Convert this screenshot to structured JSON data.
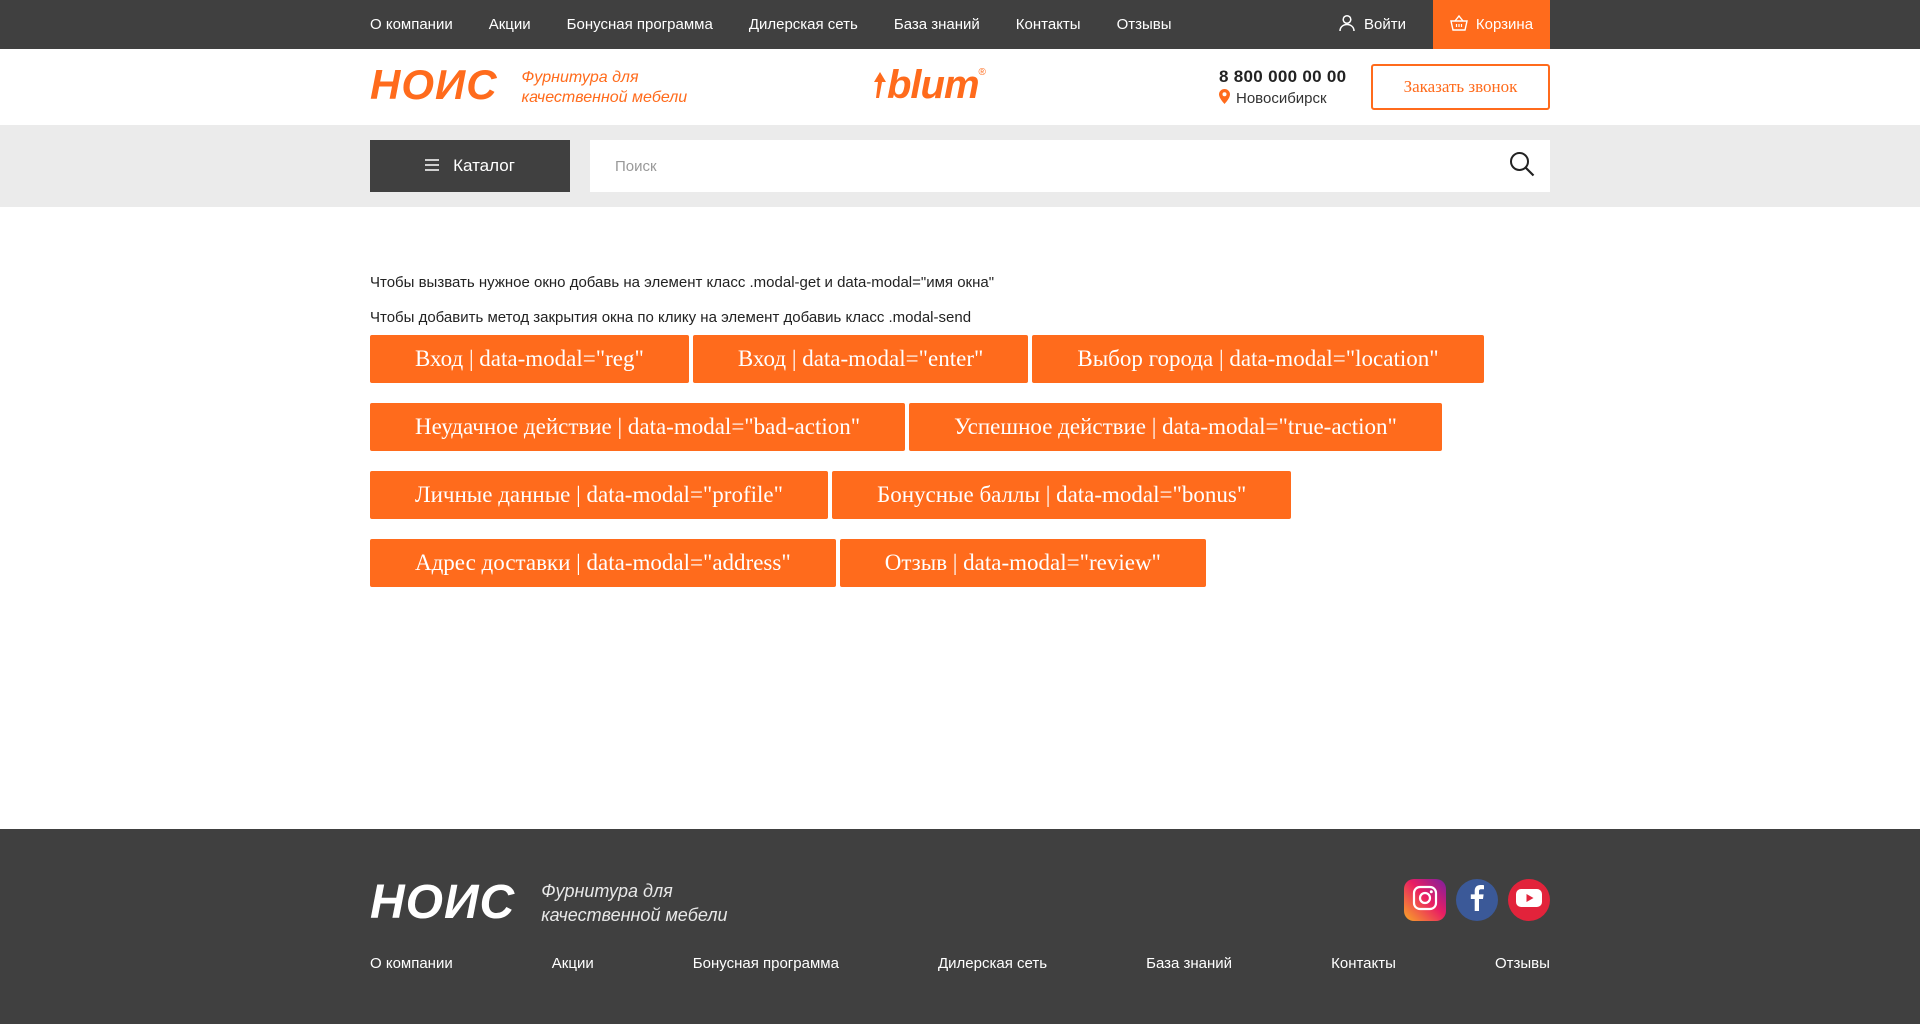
{
  "topbar": {
    "nav": [
      "О компании",
      "Акции",
      "Бонусная программа",
      "Дилерская сеть",
      "База знаний",
      "Контакты",
      "Отзывы"
    ],
    "login_label": "Войти",
    "cart_label": "Корзина"
  },
  "header": {
    "logo_text": "НОИС",
    "logo_tagline": "Фурнитура для качественной мебели",
    "brand_text": "blum",
    "brand_reg": "®",
    "phone": "8 800 000 00 00",
    "city": "Новосибирск",
    "callback_label": "Заказать звонок"
  },
  "search_band": {
    "catalog_label": "Каталог",
    "search_placeholder": "Поиск"
  },
  "main": {
    "note1": "Чтобы вызвать нужное окно добавь на элемент класс .modal-get и data-modal=\"имя окна\"",
    "note2": "Чтобы добавить метод закрытия окна по клику на элемент добавиь класс .modal-send",
    "rows": [
      [
        "Вход | data-modal=\"reg\"",
        "Вход | data-modal=\"enter\"",
        "Выбор города | data-modal=\"location\""
      ],
      [
        "Неудачное действие | data-modal=\"bad-action\"",
        "Успешное действие | data-modal=\"true-action\""
      ],
      [
        "Личные данные | data-modal=\"profile\"",
        "Бонусные баллы | data-modal=\"bonus\""
      ],
      [
        "Адрес доставки | data-modal=\"address\"",
        "Отзыв | data-modal=\"review\""
      ]
    ]
  },
  "footer": {
    "logo_text": "НОИС",
    "logo_tagline": "Фурнитура для качественной мебели",
    "nav": [
      "О компании",
      "Акции",
      "Бонусная программа",
      "Дилерская сеть",
      "База знаний",
      "Контакты",
      "Отзывы"
    ],
    "social": [
      "instagram-icon",
      "facebook-icon",
      "youtube-icon"
    ]
  },
  "colors": {
    "accent": "#ff6b1c",
    "dark": "#404040",
    "band": "#ebebeb"
  }
}
